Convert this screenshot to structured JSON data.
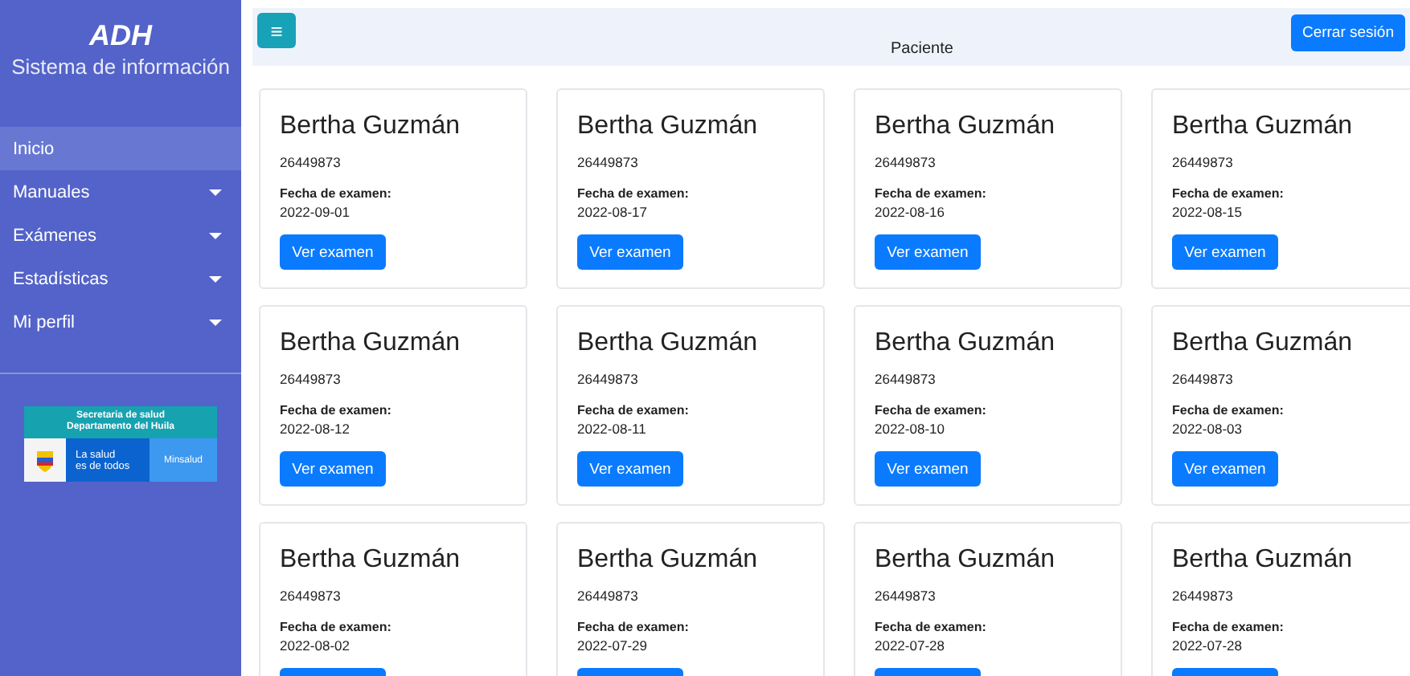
{
  "sidebar": {
    "brand": "ADH",
    "subtitle": "Sistema de información",
    "items": [
      {
        "label": "Inicio",
        "selected": true,
        "expandable": false
      },
      {
        "label": "Manuales",
        "selected": false,
        "expandable": true
      },
      {
        "label": "Exámenes",
        "selected": false,
        "expandable": true
      },
      {
        "label": "Estadísticas",
        "selected": false,
        "expandable": true
      },
      {
        "label": "Mi perfil",
        "selected": false,
        "expandable": true
      }
    ],
    "logo": {
      "line_1": "Secretaria de salud",
      "line_2": "Departamento del Huila",
      "slogan_1": "La salud",
      "slogan_2": "es de todos",
      "ministry": "Minsalud"
    }
  },
  "topbar": {
    "menu_icon": "≡",
    "title": "Paciente",
    "logout": "Cerrar sesión"
  },
  "cards": [
    {
      "name": "Bertha Guzmán",
      "id": "26449873",
      "date_label": "Fecha de examen:",
      "date": "2022-09-01",
      "button": "Ver examen"
    },
    {
      "name": "Bertha Guzmán",
      "id": "26449873",
      "date_label": "Fecha de examen:",
      "date": "2022-08-17",
      "button": "Ver examen"
    },
    {
      "name": "Bertha Guzmán",
      "id": "26449873",
      "date_label": "Fecha de examen:",
      "date": "2022-08-16",
      "button": "Ver examen"
    },
    {
      "name": "Bertha Guzmán",
      "id": "26449873",
      "date_label": "Fecha de examen:",
      "date": "2022-08-15",
      "button": "Ver examen"
    },
    {
      "name": "Bertha Guzmán",
      "id": "26449873",
      "date_label": "Fecha de examen:",
      "date": "2022-08-12",
      "button": "Ver examen"
    },
    {
      "name": "Bertha Guzmán",
      "id": "26449873",
      "date_label": "Fecha de examen:",
      "date": "2022-08-11",
      "button": "Ver examen"
    },
    {
      "name": "Bertha Guzmán",
      "id": "26449873",
      "date_label": "Fecha de examen:",
      "date": "2022-08-10",
      "button": "Ver examen"
    },
    {
      "name": "Bertha Guzmán",
      "id": "26449873",
      "date_label": "Fecha de examen:",
      "date": "2022-08-03",
      "button": "Ver examen"
    },
    {
      "name": "Bertha Guzmán",
      "id": "26449873",
      "date_label": "Fecha de examen:",
      "date": "2022-08-02"
    },
    {
      "name": "Bertha Guzmán",
      "id": "26449873",
      "date_label": "Fecha de examen:",
      "date": "2022-07-29"
    },
    {
      "name": "Bertha Guzmán",
      "id": "26449873",
      "date_label": "Fecha de examen:",
      "date": "2022-07-28"
    },
    {
      "name": "Bertha Guzmán",
      "id": "26449873",
      "date_label": "Fecha de examen:",
      "date": "2022-07-28"
    }
  ]
}
